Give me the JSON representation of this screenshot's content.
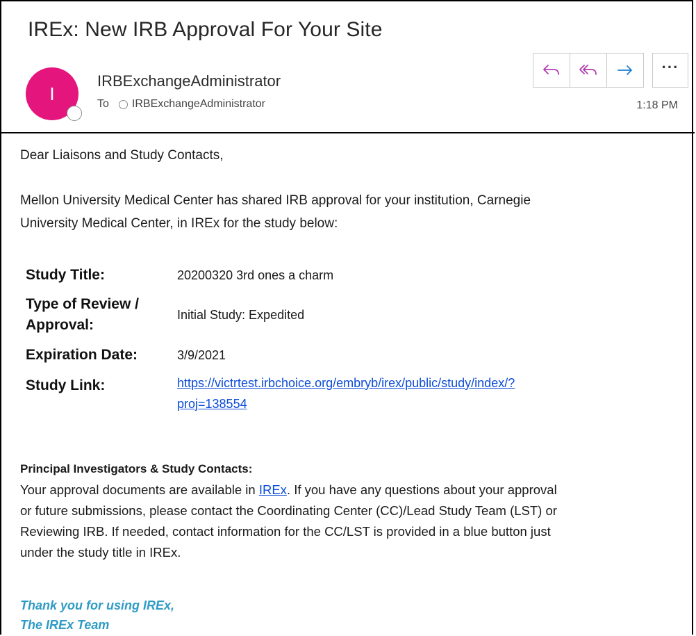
{
  "email": {
    "subject": "IREx: New IRB Approval For Your Site",
    "avatar_initial": "I",
    "sender": "IRBExchangeAdministrator",
    "to_label": "To",
    "recipient": "IRBExchangeAdministrator",
    "time": "1:18 PM",
    "avatar_color": "#e5157e",
    "action_icon_color": "#b03cb0"
  },
  "actions": {
    "reply_icon": "reply-icon",
    "reply_all_icon": "reply-all-icon",
    "forward_icon": "forward-icon",
    "more_label": "···"
  },
  "body": {
    "greeting": "Dear Liaisons and Study Contacts,",
    "intro_line1": "Mellon University Medical Center has shared IRB approval for your institution, Carnegie",
    "intro_line2": "University Medical Center, in IREx for the study below:",
    "details": {
      "study_title_label": "Study Title:",
      "study_title_value": "20200320 3rd ones a charm",
      "review_label_line1": "Type of Review /",
      "review_label_line2": "Approval:",
      "review_value": "Initial Study: Expedited",
      "expiration_label": "Expiration Date:",
      "expiration_value": "3/9/2021",
      "link_label": "Study Link:",
      "link_line1": "https://victrtest.irbchoice.org/embryb/irex/public/study/index/?",
      "link_line2": "proj=138554"
    },
    "pi_heading": "Principal Investigators & Study Contacts:",
    "pi_text_before_link": "Your approval documents are available in ",
    "pi_link": "IREx",
    "pi_text_after_link": ". If you have any questions about your approval",
    "pi_line2": "or future submissions, please contact the Coordinating Center (CC)/Lead Study Team (LST) or",
    "pi_line3": "Reviewing IRB. If needed, contact information for the CC/LST is provided in a blue button just",
    "pi_line4": "under the study title in IREx.",
    "signoff_line1": "Thank you for using IREx,",
    "signoff_line2": "The IREx Team"
  }
}
